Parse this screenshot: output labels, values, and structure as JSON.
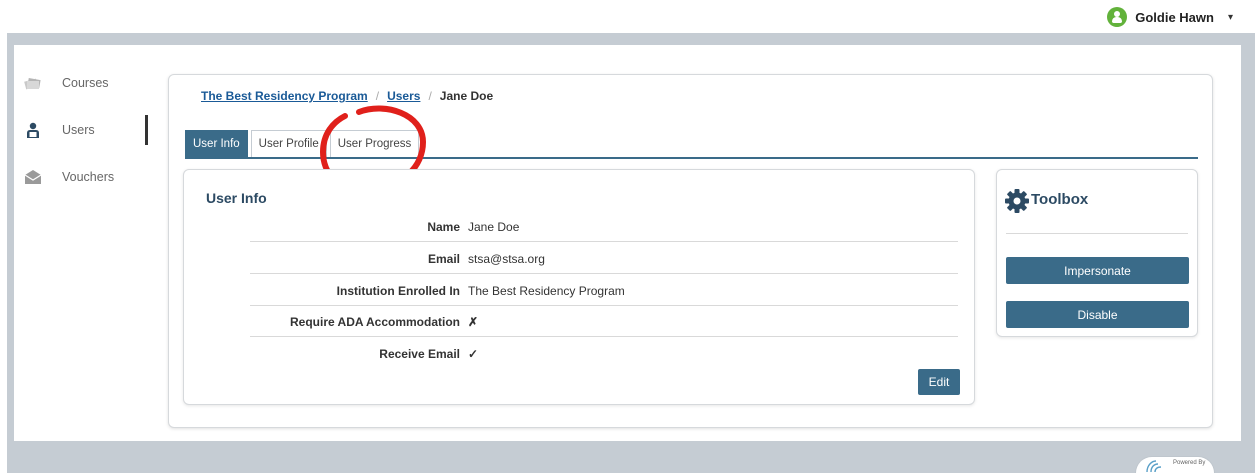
{
  "user_menu": {
    "name": "Goldie Hawn",
    "caret": "▾"
  },
  "sidebar": {
    "items": [
      {
        "label": "Courses",
        "icon": "courses-icon"
      },
      {
        "label": "Users",
        "icon": "users-icon",
        "active": true
      },
      {
        "label": "Vouchers",
        "icon": "vouchers-icon"
      }
    ]
  },
  "breadcrumb": {
    "program": "The Best Residency Program",
    "sep1": "/",
    "users": "Users",
    "sep2": "/",
    "current": "Jane Doe"
  },
  "tabs": [
    {
      "label": "User Info",
      "active": true
    },
    {
      "label": "User Profile",
      "active": false
    },
    {
      "label": "User Progress",
      "active": false
    }
  ],
  "user_info": {
    "title": "User Info",
    "rows": [
      {
        "label": "Name",
        "value": "Jane Doe"
      },
      {
        "label": "Email",
        "value": "stsa@stsa.org"
      },
      {
        "label": "Institution Enrolled In",
        "value": "The Best Residency Program"
      },
      {
        "label": "Require ADA Accommodation",
        "value": "✗"
      },
      {
        "label": "Receive Email",
        "value": "✓"
      }
    ],
    "edit_label": "Edit"
  },
  "toolbox": {
    "title": "Toolbox",
    "impersonate_label": "Impersonate",
    "disable_label": "Disable"
  },
  "footer": {
    "powered_by": "Powered By"
  },
  "colors": {
    "primary": "#3a6b89",
    "frame": "#c5ccd3",
    "link": "#1a5a97",
    "annotation": "#e0201b"
  }
}
